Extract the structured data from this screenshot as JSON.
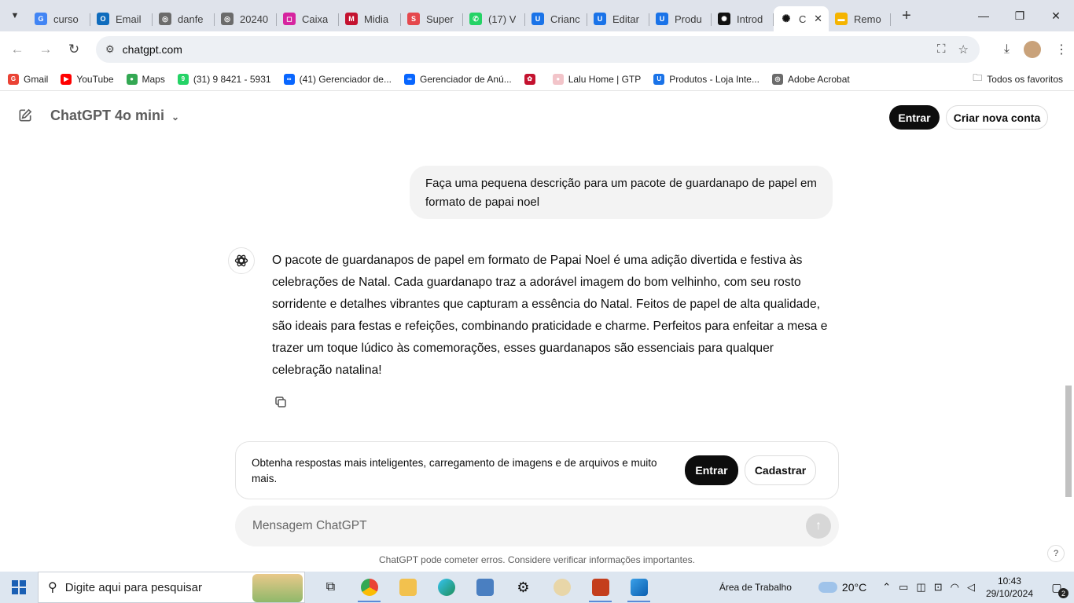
{
  "browser": {
    "tabs": [
      {
        "label": "curso",
        "color": "#4285f4",
        "glyph": "G"
      },
      {
        "label": "Email",
        "color": "#0f6cbd",
        "glyph": "O"
      },
      {
        "label": "danfe",
        "color": "#6b6b6b",
        "glyph": "◎"
      },
      {
        "label": "20240",
        "color": "#6b6b6b",
        "glyph": "◎"
      },
      {
        "label": "Caixa",
        "color": "#d6249f",
        "glyph": "◻"
      },
      {
        "label": "Midia",
        "color": "#c4122f",
        "glyph": "M"
      },
      {
        "label": "Super",
        "color": "#e5484d",
        "glyph": "S"
      },
      {
        "label": "(17) V",
        "color": "#25d366",
        "glyph": "✆"
      },
      {
        "label": "Crianc",
        "color": "#1a73e8",
        "glyph": "U"
      },
      {
        "label": "Editar",
        "color": "#1a73e8",
        "glyph": "U"
      },
      {
        "label": "Produ",
        "color": "#1a73e8",
        "glyph": "U"
      },
      {
        "label": "Introd",
        "color": "#111111",
        "glyph": "✺"
      }
    ],
    "active_tab": {
      "label": "C",
      "close": "✕"
    },
    "last_tab": {
      "label": "Remo",
      "color": "#f5b400",
      "glyph": "▬"
    },
    "new_tab": "+",
    "url": "chatgpt.com",
    "bookmarks": [
      {
        "label": "Gmail",
        "color": "#ea4335",
        "glyph": "G"
      },
      {
        "label": "YouTube",
        "color": "#ff0000",
        "glyph": "▶"
      },
      {
        "label": "Maps",
        "color": "#34a853",
        "glyph": "●"
      },
      {
        "label": "(31) 9 8421 - 5931",
        "color": "#25d366",
        "glyph": "9"
      },
      {
        "label": "(41) Gerenciador de...",
        "color": "#0866ff",
        "glyph": "∞"
      },
      {
        "label": "Gerenciador de Anú...",
        "color": "#0866ff",
        "glyph": "∞"
      },
      {
        "label": "",
        "color": "#c4122f",
        "glyph": "✿"
      },
      {
        "label": "Lalu Home | GTP",
        "color": "#f2c4c9",
        "glyph": "●"
      },
      {
        "label": "Produtos - Loja Inte...",
        "color": "#1a73e8",
        "glyph": "U"
      },
      {
        "label": "Adobe Acrobat",
        "color": "#6b6b6b",
        "glyph": "◎"
      }
    ],
    "all_bookmarks": "Todos os favoritos"
  },
  "chat": {
    "model": "ChatGPT 4o mini",
    "login": "Entrar",
    "signup": "Criar nova conta",
    "user_message": "Faça uma pequena descrição para um pacote de guardanapo de papel em formato de papai noel",
    "assistant_message": "O pacote de guardanapos de papel em formato de Papai Noel é uma adição divertida e festiva às celebrações de Natal. Cada guardanapo traz a adorável imagem do bom velhinho, com seu rosto sorridente e detalhes vibrantes que capturam a essência do Natal. Feitos de papel de alta qualidade, são ideais para festas e refeições, combinando praticidade e charme. Perfeitos para enfeitar a mesa e trazer um toque lúdico às comemorações, esses guardanapos são essenciais para qualquer celebração natalina!",
    "promo_text": "Obtenha respostas mais inteligentes, carregamento de imagens e de arquivos e muito mais.",
    "promo_login": "Entrar",
    "promo_signup": "Cadastrar",
    "composer_placeholder": "Mensagem ChatGPT",
    "disclaimer": "ChatGPT pode cometer erros. Considere verificar informações importantes.",
    "help": "?"
  },
  "taskbar": {
    "search_placeholder": "Digite aqui para pesquisar",
    "desktop_label": "Área de Trabalho",
    "temperature": "20°C",
    "time": "10:43",
    "date": "29/10/2024",
    "notification_count": "2"
  }
}
